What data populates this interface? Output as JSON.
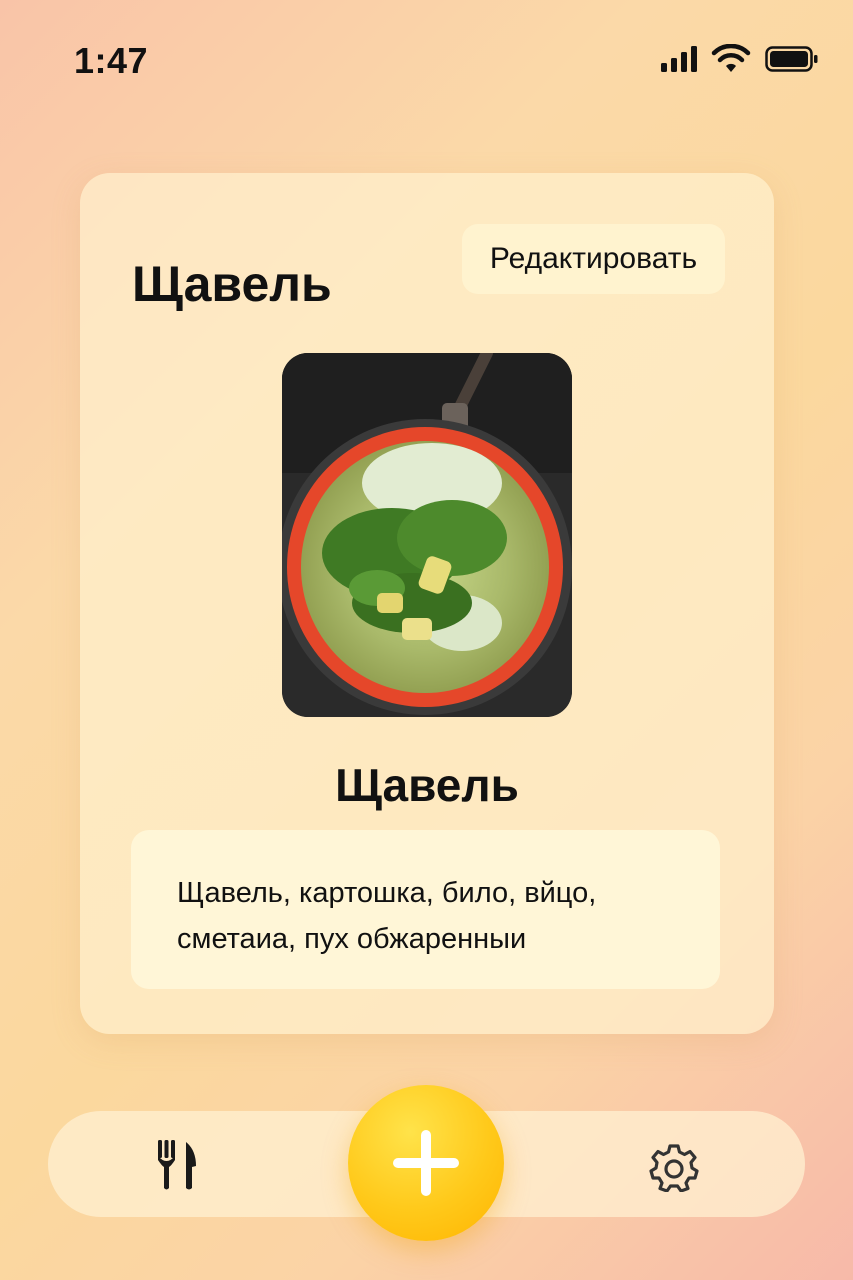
{
  "status_bar": {
    "time": "1:47",
    "icons": [
      "cellular-signal-icon",
      "wifi-icon",
      "battery-icon"
    ]
  },
  "card": {
    "title": "Щавель",
    "edit_label": "Редактировать",
    "image": "soup-pan-photo",
    "dish_name": "Щавель",
    "ingredients": "Щавель, картошка, било, вйцо, сметаиа, пух обжаренныи"
  },
  "tab_bar": {
    "left_icon": "fork-knife-icon",
    "center_icon": "plus-icon",
    "right_icon": "gear-icon"
  },
  "colors": {
    "accent": "#ffc91a",
    "card_bg": "#fff0cd",
    "text": "#111111"
  }
}
